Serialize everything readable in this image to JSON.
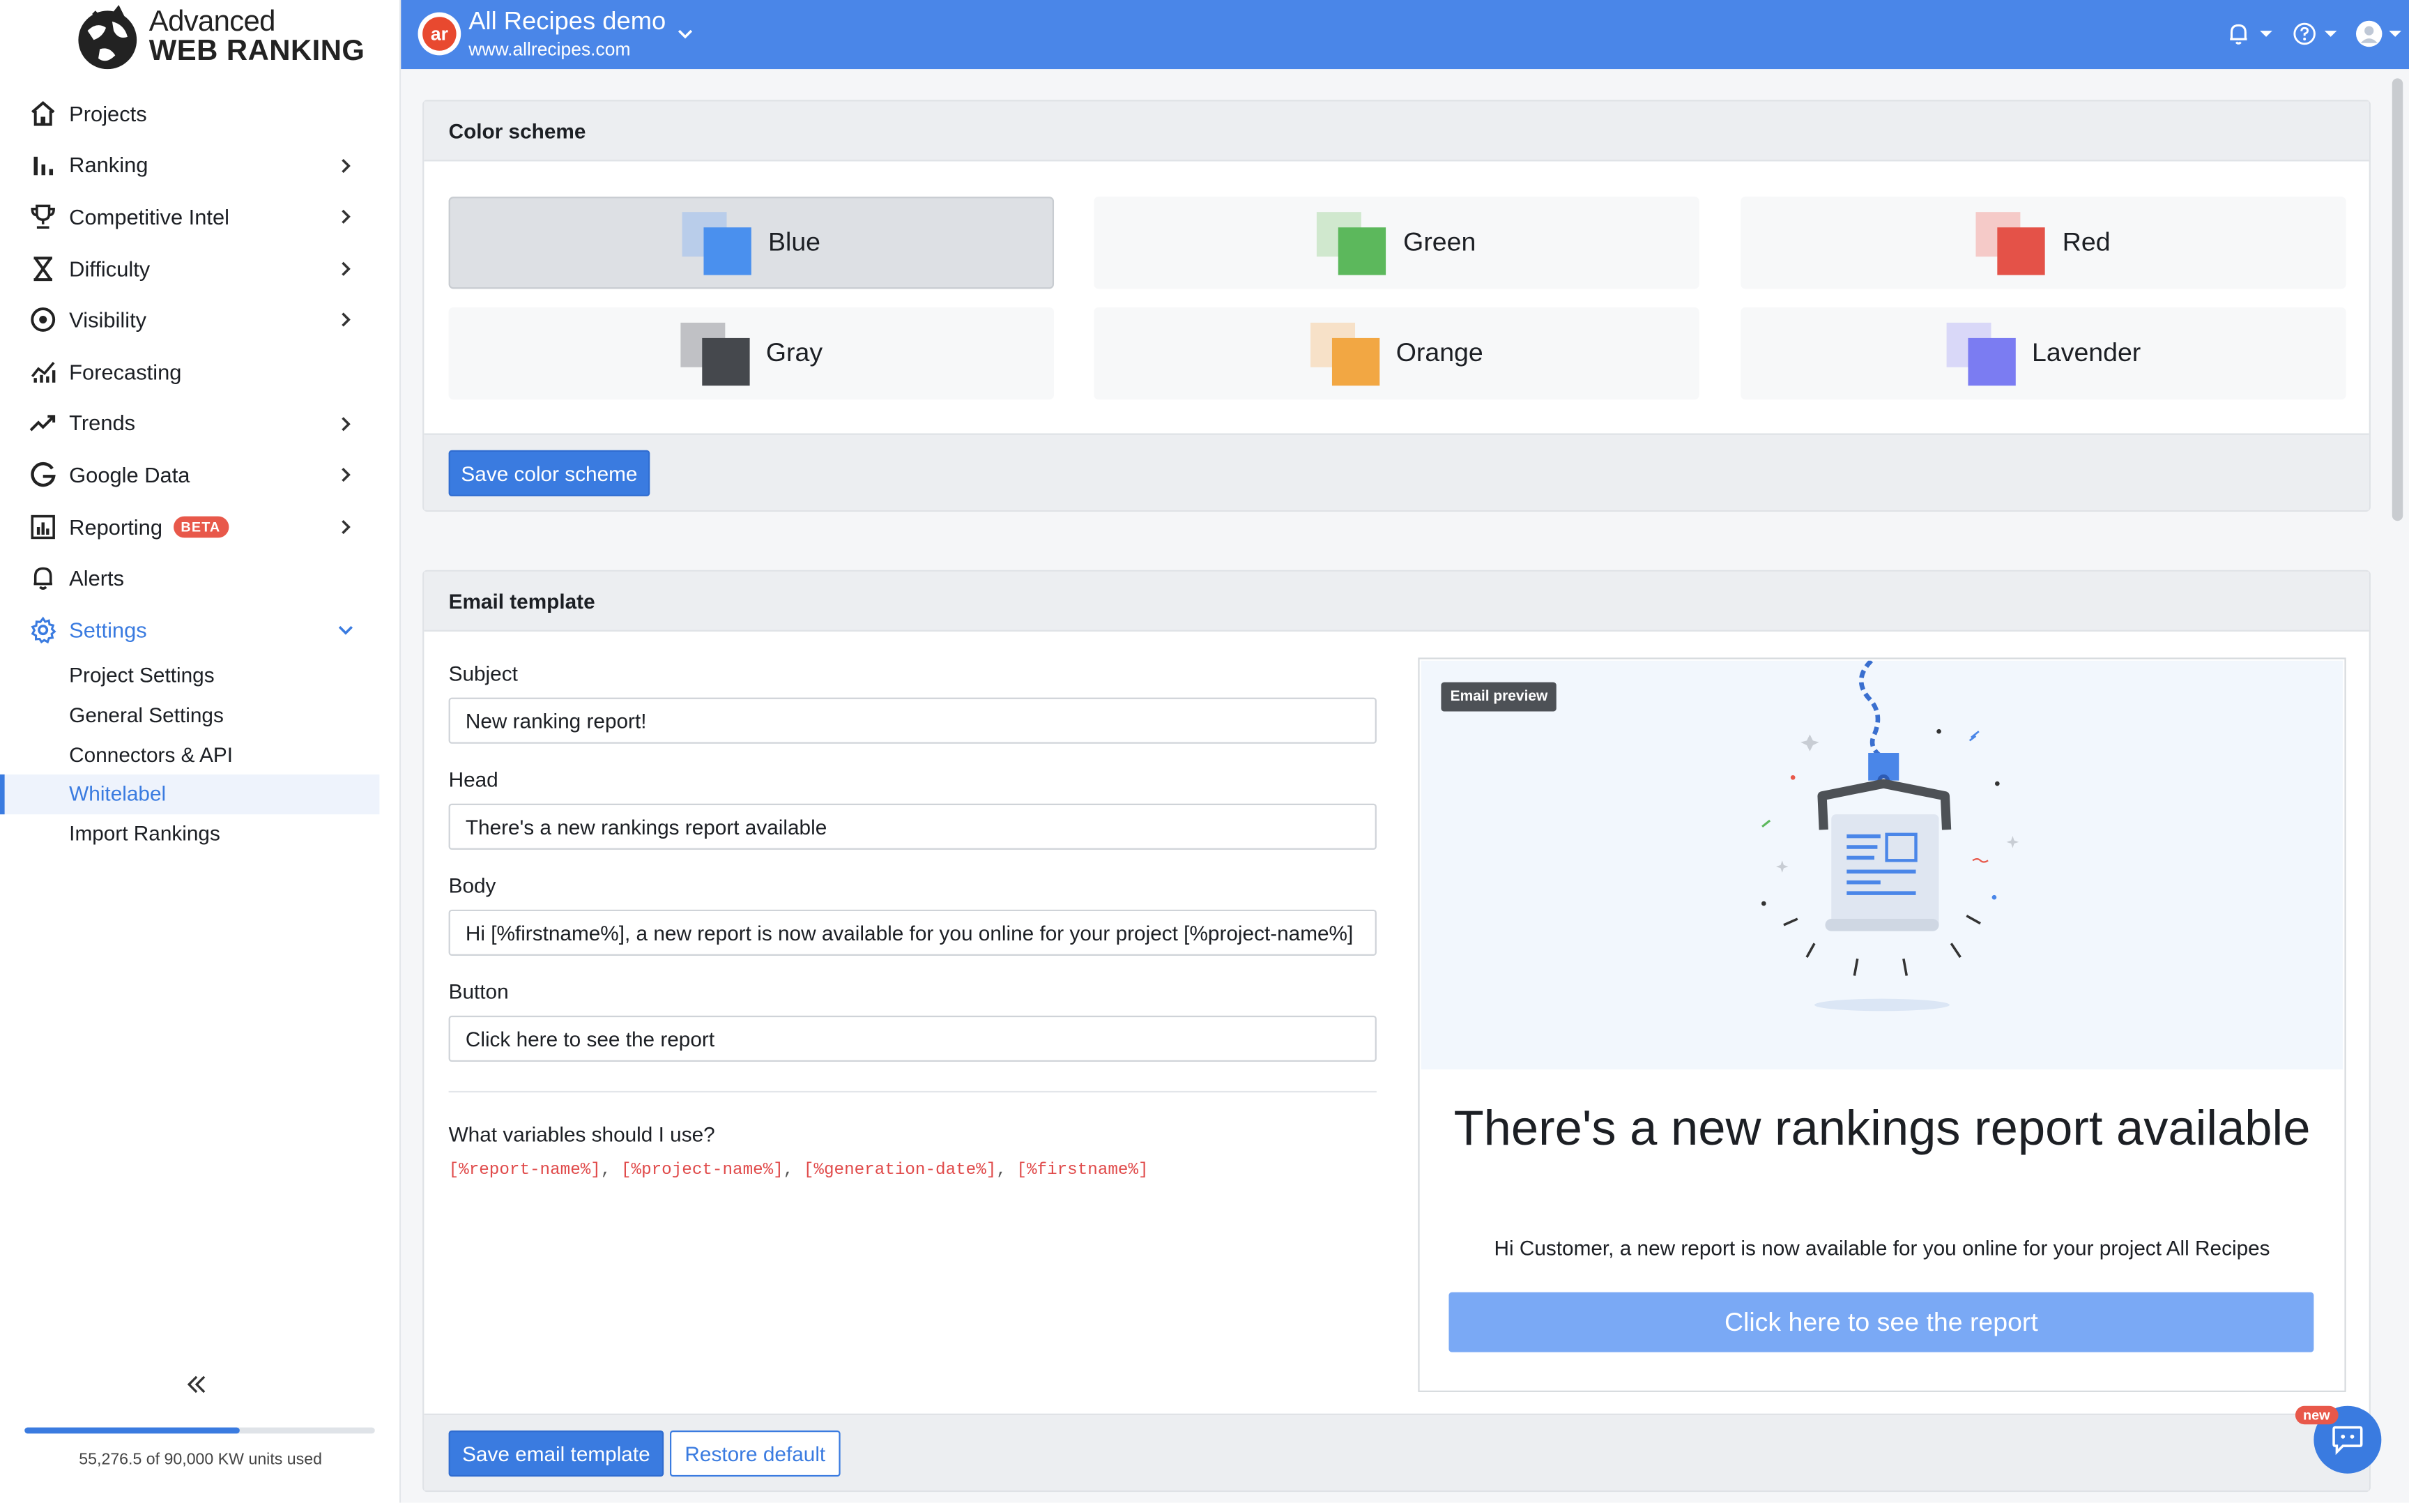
{
  "brand": {
    "line1": "Advanced",
    "line2": "WEB RANKING"
  },
  "nav": {
    "items": [
      {
        "label": "Projects"
      },
      {
        "label": "Ranking"
      },
      {
        "label": "Competitive Intel"
      },
      {
        "label": "Difficulty"
      },
      {
        "label": "Visibility"
      },
      {
        "label": "Forecasting"
      },
      {
        "label": "Trends"
      },
      {
        "label": "Google Data"
      },
      {
        "label": "Reporting",
        "badge": "BETA"
      },
      {
        "label": "Alerts"
      },
      {
        "label": "Settings"
      }
    ],
    "settings_sub": [
      {
        "label": "Project Settings"
      },
      {
        "label": "General Settings"
      },
      {
        "label": "Connectors & API"
      },
      {
        "label": "Whitelabel"
      },
      {
        "label": "Import Rankings"
      }
    ]
  },
  "usage": {
    "text": "55,276.5 of 90,000 KW units used",
    "fraction": 0.614
  },
  "header": {
    "project_title": "All Recipes demo",
    "project_url": "www.allrecipes.com",
    "project_logo": "ar"
  },
  "color_scheme": {
    "title": "Color scheme",
    "options": [
      {
        "label": "Blue",
        "light": "#8fb6f2",
        "dark": "#4a90ee",
        "selected": true
      },
      {
        "label": "Green",
        "light": "#9fd59a",
        "dark": "#5cb85c"
      },
      {
        "label": "Red",
        "light": "#f1938b",
        "dark": "#e45248"
      },
      {
        "label": "Gray",
        "light": "#7c7f84",
        "dark": "#45484d"
      },
      {
        "label": "Orange",
        "light": "#f6c68b",
        "dark": "#f2a743"
      },
      {
        "label": "Lavender",
        "light": "#b4b2f7",
        "dark": "#7b7cf2"
      }
    ],
    "save_label": "Save color scheme"
  },
  "email": {
    "title": "Email template",
    "subject_label": "Subject",
    "subject_value": "New ranking report!",
    "head_label": "Head",
    "head_value": "There's a new rankings report available",
    "body_label": "Body",
    "body_value": "Hi [%firstname%], a new report is now available for you online for your project [%project-name%]",
    "button_label": "Button",
    "button_value": "Click here to see the report",
    "vars_title": "What variables should I use?",
    "vars": [
      "[%report-name%]",
      "[%project-name%]",
      "[%generation-date%]",
      "[%firstname%]"
    ],
    "save_label": "Save email template",
    "restore_label": "Restore default"
  },
  "preview": {
    "badge": "Email preview",
    "heading": "There's a new rankings report available",
    "body": "Hi Customer, a new report is now available for you online for your project All Recipes",
    "button": "Click here to see the report"
  },
  "chat": {
    "badge": "new"
  },
  "colors": {
    "accent": "#3a7be0",
    "header_bg": "#4a86e8",
    "beta": "#e8584a"
  }
}
